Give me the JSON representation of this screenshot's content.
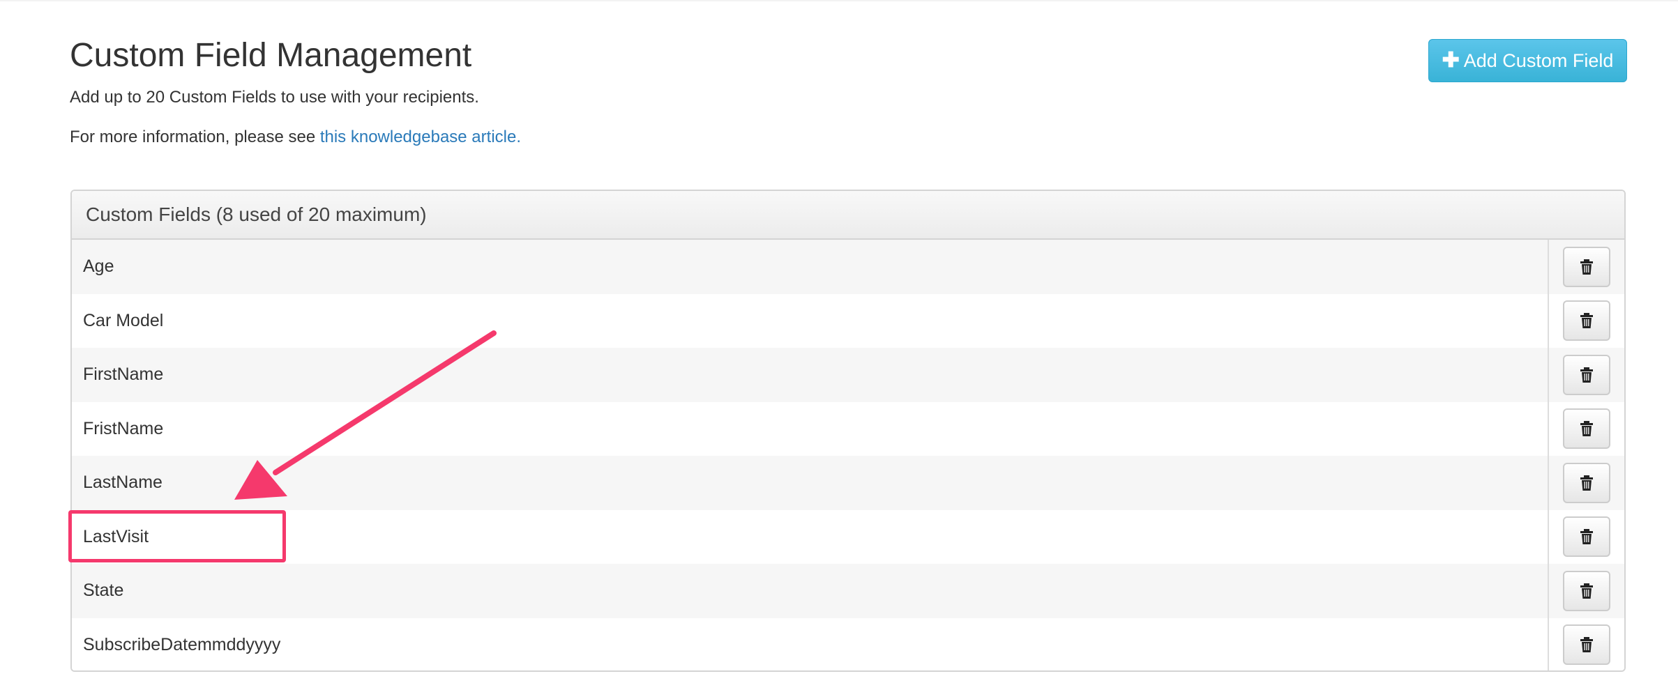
{
  "header": {
    "title": "Custom Field Management",
    "subtitle": "Add up to 20 Custom Fields to use with your recipients.",
    "info_prefix": "For more information, please see ",
    "info_link": "this knowledgebase article.",
    "add_button_label": "Add Custom Field",
    "add_button_icon": "plus-icon"
  },
  "panel": {
    "heading": "Custom Fields (8 used of 20 maximum)",
    "rows": [
      {
        "label": "Age"
      },
      {
        "label": "Car Model"
      },
      {
        "label": "FirstName"
      },
      {
        "label": "FristName"
      },
      {
        "label": "LastName"
      },
      {
        "label": "LastVisit"
      },
      {
        "label": "State"
      },
      {
        "label": "SubscribeDatemmddyyyy"
      }
    ],
    "delete_icon": "trash-icon"
  },
  "annotation": {
    "highlighted_row": "LastVisit",
    "color": "#f5396c"
  },
  "colors": {
    "accent": "#39b3d7",
    "link": "#2a7ab9"
  }
}
